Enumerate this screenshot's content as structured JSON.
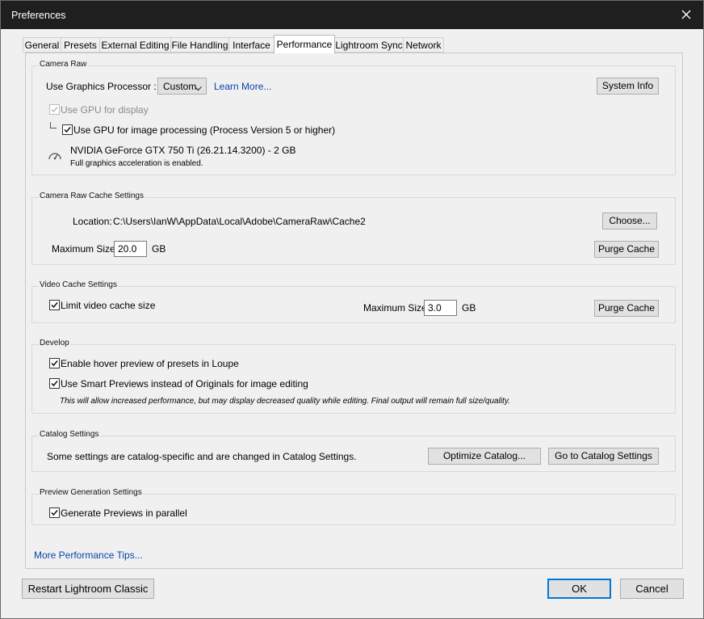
{
  "window": {
    "title": "Preferences"
  },
  "tabs": [
    {
      "label": "General"
    },
    {
      "label": "Presets"
    },
    {
      "label": "External Editing"
    },
    {
      "label": "File Handling"
    },
    {
      "label": "Interface"
    },
    {
      "label": "Performance",
      "active": true
    },
    {
      "label": "Lightroom Sync"
    },
    {
      "label": "Network"
    }
  ],
  "camera_raw": {
    "title": "Camera Raw",
    "gpu_label": "Use Graphics Processor :",
    "gpu_value": "Custom",
    "learn_more": "Learn More...",
    "system_info": "System Info",
    "gpu_display_label": "Use GPU for display",
    "gpu_display_checked": true,
    "gpu_display_disabled": true,
    "gpu_processing_label": "Use GPU for image processing (Process Version 5 or higher)",
    "gpu_processing_checked": true,
    "gpu_name": "NVIDIA GeForce GTX 750 Ti (26.21.14.3200) - 2 GB",
    "gpu_status": "Full graphics acceleration is enabled."
  },
  "cache": {
    "title": "Camera Raw Cache Settings",
    "location_label": "Location:",
    "location_value": "C:\\Users\\IanW\\AppData\\Local\\Adobe\\CameraRaw\\Cache2",
    "choose": "Choose...",
    "max_size_label": "Maximum Size:",
    "max_size_value": "20.0",
    "unit": "GB",
    "purge": "Purge Cache"
  },
  "video_cache": {
    "title": "Video Cache Settings",
    "limit_label": "Limit video cache size",
    "limit_checked": true,
    "max_size_label": "Maximum Size:",
    "max_size_value": "3.0",
    "unit": "GB",
    "purge": "Purge Cache"
  },
  "develop": {
    "title": "Develop",
    "hover_label": "Enable hover preview of presets in Loupe",
    "hover_checked": true,
    "smart_label": "Use Smart Previews instead of Originals for image editing",
    "smart_checked": true,
    "note": "This will allow increased performance, but may display decreased quality while editing. Final output will remain full size/quality."
  },
  "catalog": {
    "title": "Catalog Settings",
    "text": "Some settings are catalog-specific and are changed in Catalog Settings.",
    "optimize": "Optimize Catalog...",
    "goto": "Go to Catalog Settings"
  },
  "preview": {
    "title": "Preview Generation Settings",
    "parallel_label": "Generate Previews in parallel",
    "parallel_checked": true
  },
  "more_tips": "More Performance Tips...",
  "footer": {
    "restart": "Restart Lightroom Classic",
    "ok": "OK",
    "cancel": "Cancel"
  },
  "icons": {
    "close": "close-icon",
    "check": "checkmark-icon",
    "dropdown": "chevron-down-icon",
    "gauge": "speedometer-icon",
    "tree": "tree-branch-icon"
  }
}
